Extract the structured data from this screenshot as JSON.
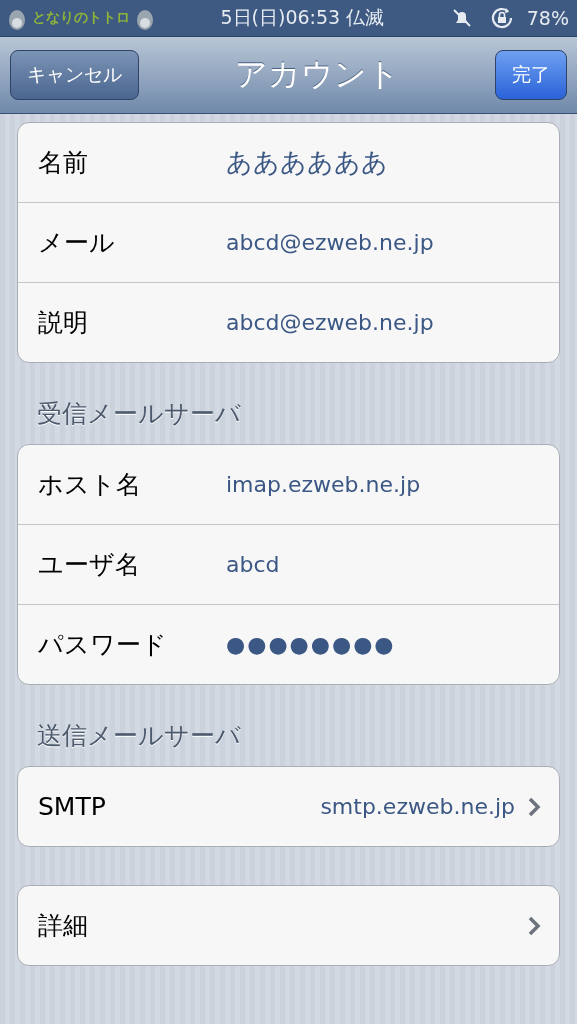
{
  "status_bar": {
    "logo_text": "となりのトトロ",
    "time": "5日(日)06:53 仏滅",
    "battery": "78%"
  },
  "nav_bar": {
    "cancel": "キャンセル",
    "title": "アカウント",
    "done": "完了"
  },
  "sections": [
    {
      "rows": [
        {
          "label": "名前",
          "value": "ああああああ",
          "kind": "field"
        },
        {
          "label": "メール",
          "value": "abcd@ezweb.ne.jp",
          "kind": "field"
        },
        {
          "label": "説明",
          "value": "abcd@ezweb.ne.jp",
          "kind": "field"
        }
      ]
    },
    {
      "header": "受信メールサーバ",
      "rows": [
        {
          "label": "ホスト名",
          "value": "imap.ezweb.ne.jp",
          "kind": "field"
        },
        {
          "label": "ユーザ名",
          "value": "abcd",
          "kind": "field"
        },
        {
          "label": "パスワード",
          "value": "●●●●●●●●",
          "kind": "password"
        }
      ]
    },
    {
      "header": "送信メールサーバ",
      "rows": [
        {
          "label": "SMTP",
          "value": "smtp.ezweb.ne.jp",
          "kind": "link"
        }
      ]
    },
    {
      "rows": [
        {
          "label": "詳細",
          "kind": "link"
        }
      ]
    }
  ]
}
